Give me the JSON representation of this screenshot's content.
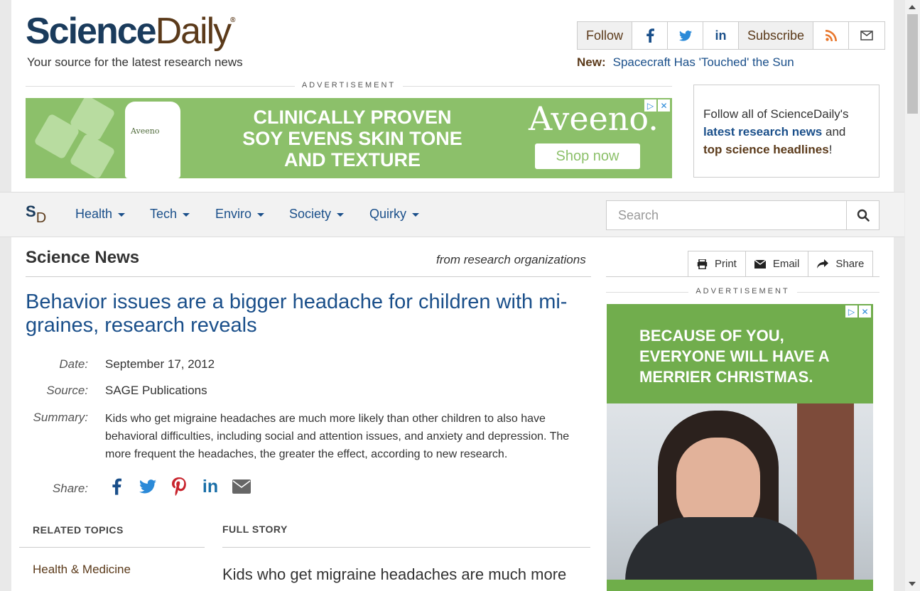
{
  "header": {
    "logo_science": "Science",
    "logo_daily": "Daily",
    "logo_reg": "®",
    "tagline": "Your source for the latest research news",
    "toolbar": {
      "follow": "Follow",
      "subscribe": "Subscribe"
    },
    "new_label": "New:",
    "new_link": "Spacecraft Has 'Touched' the Sun"
  },
  "ads": {
    "label": "ADVERTISEMENT",
    "banner": {
      "headline_1": "CLINICALLY PROVEN",
      "headline_2": "SOY EVENS SKIN TONE",
      "headline_3": "AND TEXTURE",
      "brand": "Aveeno.",
      "bottle_brand": "Aveeno",
      "cta": "Shop now"
    },
    "side": {
      "message": "BECAUSE OF YOU, EVERYONE WILL HAVE A MERRIER CHRISTMAS."
    }
  },
  "follow_box": {
    "text_1": "Follow all of ScienceDaily's",
    "link_1": "latest research news",
    "text_2": "and",
    "link_2": "top science headlines",
    "text_3": "!"
  },
  "nav": {
    "logo_s": "S",
    "logo_d": "D",
    "items": [
      "Health",
      "Tech",
      "Enviro",
      "Society",
      "Quirky"
    ],
    "search_placeholder": "Search"
  },
  "article": {
    "section_title": "Science News",
    "section_sub": "from research organizations",
    "tools": {
      "print": "Print",
      "email": "Email",
      "share": "Share"
    },
    "headline": "Behavior issues are a bigger headache for children with mi-graines, research reveals",
    "date_label": "Date:",
    "date": "September 17, 2012",
    "source_label": "Source:",
    "source": "SAGE Publications",
    "summary_label": "Summary:",
    "summary": "Kids who get migraine headaches are much more likely than other children to also have behavioral difficulties, including social and attention issues, and anxiety and depression. The more frequent the headaches, the greater the effect, according to new research.",
    "share_label": "Share:",
    "related_title": "RELATED TOPICS",
    "related_link": "Health & Medicine",
    "full_story_title": "FULL STORY",
    "full_story_start": "Kids who get migraine headaches are much more"
  },
  "colors": {
    "brand_blue": "#1a3b5c",
    "brand_brown": "#5b3a1a",
    "link_blue": "#1a4f8a",
    "ad_green": "#8cc06a"
  }
}
